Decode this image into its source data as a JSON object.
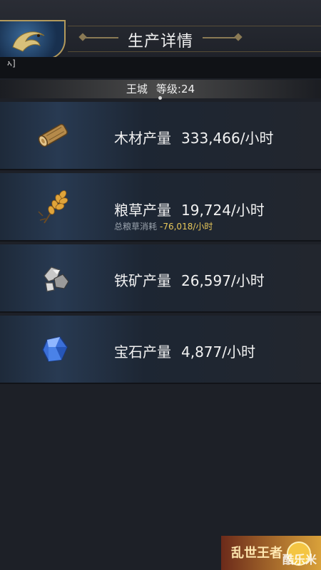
{
  "header": {
    "title": "生产详情",
    "back_icon": "dragon-emblem-icon",
    "corner_glyph": "ኣ]"
  },
  "sub_bar": {
    "city": "王城",
    "level": "等级:24"
  },
  "resources": [
    {
      "icon": "wood-log-icon",
      "label": "木材产量",
      "value": "333,466/小时"
    },
    {
      "icon": "wheat-icon",
      "label": "粮草产量",
      "value": "19,724/小时",
      "sub_label": "总粮草消耗",
      "sub_value": "-76,018/小时"
    },
    {
      "icon": "iron-ore-icon",
      "label": "铁矿产量",
      "value": "26,597/小时"
    },
    {
      "icon": "gem-icon",
      "label": "宝石产量",
      "value": "4,877/小时"
    }
  ],
  "footer": {
    "logo": "乱世王者",
    "watermark": "酷乐米"
  },
  "colors": {
    "gold": "#b39a5c",
    "negative": "#e8c85a",
    "row_accent": "#283a52"
  }
}
